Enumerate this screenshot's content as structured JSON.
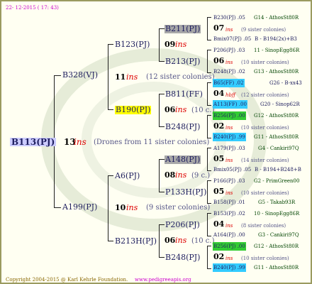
{
  "header": {
    "date": "22- 12-2015 ( 17: 43)"
  },
  "footer": {
    "copyright": "Copyright 2004-2015 @ Karl Kehrle Foundation.",
    "url": "www.pedigreeapis.org"
  },
  "colors": {
    "accent": "#dd0000",
    "gray_box": "#a8a8a8",
    "yellow_box": "#ffff00",
    "green_box": "#33cc33",
    "cyan_box": "#33ccff"
  },
  "root": {
    "name": "B113(PJ)",
    "year": "13",
    "ins": "ins",
    "note": "(Drones from 11 sister colonies)"
  },
  "g1": {
    "top": {
      "name": "B328(VJ)",
      "year": "11",
      "ins": "ins",
      "note": "(12 sister colonies)"
    },
    "bottom": {
      "name": "A199(PJ)",
      "year": "10",
      "ins": "ins",
      "note": "(9 sister colonies)"
    }
  },
  "g2": {
    "a": {
      "name": "B123(PJ)",
      "year": "09",
      "ins": "ins"
    },
    "b": {
      "name": "B190(PJ)",
      "year": "06",
      "ins": "ins",
      "note": "(10 c.)"
    },
    "c": {
      "name": "A6(PJ)",
      "year": "08",
      "ins": "ins",
      "note": "(9 c.)"
    },
    "d": {
      "name": "B213H(PJ)",
      "year": "06",
      "ins": "ins",
      "note": "(10 c.)"
    }
  },
  "g3": {
    "a1": "B211(PJ)",
    "a2": "B213(PJ)",
    "b1": "B811(FF)",
    "b2": "B248(PJ)",
    "c1": "A148(PJ)",
    "c2": "P133H(PJ)",
    "d1": "P206(PJ)",
    "d2": "B248(PJ)"
  },
  "g4": {
    "a1": {
      "l1": "B230(PJ) .05",
      "l1b": "G14 - AthosSt80R",
      "year": "07",
      "ins": "ins",
      "note": "(9 sister colonies)",
      "l3a": "Bmix07(PJ) .05",
      "l3b": "B - B194(2x)+B3"
    },
    "a2": {
      "l1": "P206(PJ) .03",
      "l1b": "11 - SinopEgg86R",
      "year": "06",
      "ins": "ins",
      "note": "(10 sister colonies)",
      "l3a": "B248(PJ) .02",
      "l3b": "G13 - AthosSt80R"
    },
    "b1": {
      "l1": "B65(FF) .02",
      "l1b": "G26 - B-xx43",
      "year": "04",
      "ins": "hbff",
      "note": "(12 sister colonies)",
      "l3a": "A113(FF) .00",
      "l3b": "G20 - Sinop62R"
    },
    "b2": {
      "l1": "B256(PJ) .00",
      "l1b": "G12 - AthosSt80R",
      "year": "02",
      "ins": "ins",
      "note": "(10 sister colonies)",
      "l3a": "B240(PJ) .99",
      "l3b": "G11 - AthosSt80R"
    },
    "c1": {
      "l1": "A179(PJ) .03",
      "l1b": "G4 - Cankiri97Q",
      "year": "05",
      "ins": "ins",
      "note": "(14 sister colonies)",
      "l3a": "Bmix05(PJ) .05",
      "l3b": "B - B194+B248+B"
    },
    "c2": {
      "l1": "P166(PJ) .03",
      "l1b": "G2 - PrimGreen00",
      "year": "05",
      "ins": "ins",
      "note": "(10 sister colonies)",
      "l3a": "B158(PJ) .01",
      "l3b": "G5 - Takab93R"
    },
    "d1": {
      "l1": "B153(PJ) .02",
      "l1b": "10 - SinopEgg86R",
      "year": "04",
      "ins": "ins",
      "note": "(8 sister colonies)",
      "l3a": "A164(PJ) .00",
      "l3b": "G3 - Cankiri97Q"
    },
    "d2": {
      "l1": "B256(PJ) .00",
      "l1b": "G12 - AthosSt80R",
      "year": "02",
      "ins": "ins",
      "note": "(10 sister colonies)",
      "l3a": "B240(PJ) .99",
      "l3b": "G11 - AthosSt80R"
    }
  }
}
